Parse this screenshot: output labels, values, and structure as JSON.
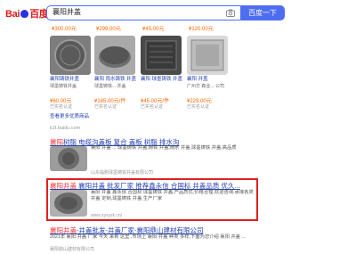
{
  "header": {
    "logo_bai": "Bai",
    "logo_du": "百度",
    "query": "襄阳井盖",
    "search_button": "百度一下"
  },
  "top_prices": [
    "¥300.00元",
    "¥299.00元",
    "¥45.00元",
    "¥120.00元"
  ],
  "products": [
    {
      "title": "襄阳铸铁井盖",
      "sub": "球墨铸铁井盖",
      "price": "¥60.00元",
      "tag": "已实名认证"
    },
    {
      "title": "襄阳 雨水铸铁 井盖",
      "sub": "球墨铸铁... 井盖",
      "price": "¥185.00元/件",
      "tag": "已实名认证"
    },
    {
      "title": "襄阳 球墨铸铁 井盖",
      "sub": "",
      "price": "¥45.00元/件",
      "tag": "已实名认证"
    },
    {
      "title": "襄阳 井盖",
      "sub": "广州方 森业... 公司",
      "price": "¥229.00元",
      "tag": "已实名认证"
    }
  ],
  "more_link": "查看更多优质商品",
  "source_url": "k2t.baidu.com",
  "results": [
    {
      "title_parts": [
        "襄阳",
        "树脂 电缆沟盖板 复合 盖板 树脂 排水沟"
      ],
      "text": "襄阳 井盖 ... 球墨铸铁 井盖,铸铁 井盖,雨水 井盖,球墨铸铁 井盖,高品质",
      "meta": "山东临朐球墨铸铁井盖有限公司"
    },
    {
      "title_parts": [
        "襄阳井盖",
        " 襄阳井盖 批发厂家 推荐鑫永信 合国标 井盖品质 优久..."
      ],
      "text": "襄阳 井盖 鑫永信 合国标 球墨铸铁 井盖,产品质优,价格合理,欢迎咨询,承接各类 井盖 定制,球墨铸铁 井盖 生产厂家",
      "meta": "www.xyxyzk.cn/"
    },
    {
      "title_parts": [
        "襄阳井盖",
        "-井盖批发-井盖厂家-襄阳鼎山建材有限公司"
      ],
      "text": "2021年 襄阳 井盖 厂家 今天 来到 这里 ,市场上 襄阳 井盖 种类 多样,下面为您介绍 襄阳 井盖 ...",
      "meta": "襄阳鼎山建材有限公司"
    }
  ],
  "colors": {
    "accent": "#4e6ef2",
    "link": "#2440b3",
    "highlight": "#f73131",
    "price": "#ff6600",
    "frame": "#e02020"
  }
}
